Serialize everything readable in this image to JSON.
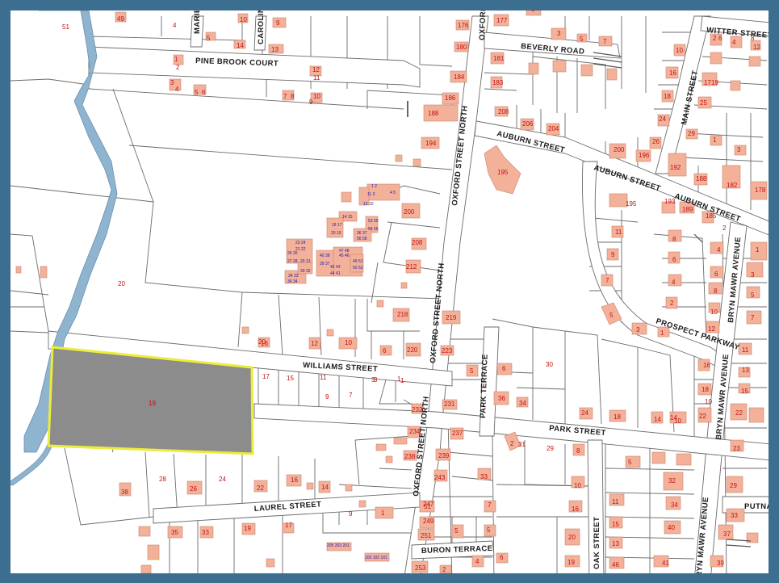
{
  "map": {
    "frame_color": "#3c6e8f",
    "highlight_outline_color": "#ecec3a",
    "highlight_fill_color": "#8c8c8c",
    "building_color": "#f4b19a",
    "water_color": "#8fb4cf",
    "label_color": "#c01010"
  },
  "streets": {
    "pine_brook_court": "PINE BROOK COURT",
    "beverly_road": "BEVERLY ROAD",
    "witter_street": "WITTER STREET",
    "main_street": "MAIN STREET",
    "auburn_street_1": "AUBURN STREET",
    "auburn_street_2": "AUBURN STREET",
    "auburn_street_3": "AUBURN STREET",
    "oxford_street_north_1": "OXFORD STREET NORTH",
    "oxford_street_north_2": "OXFORD STREET NORTH",
    "oxford_street_north_3": "OXFORD STREET NORTH",
    "oxford_top": "OXFORD",
    "marie": "MARIE",
    "carolina": "CAROLINA",
    "williams_street": "WILLIAMS STREET",
    "park_terrace": "PARK TERRACE",
    "park_street": "PARK STREET",
    "prospect_parkway": "PROSPECT PARKWAY",
    "bryn_mawr_avenue_1": "BRYN MAWR AVENUE",
    "bryn_mawr_avenue_2": "BRYN MAWR AVENUE",
    "bryn_mawr_avenue_3": "BRYN MAWR AVENUE",
    "laurel_street": "LAUREL STREET",
    "oak_street": "OAK STREET",
    "buron_terrace": "BURON TERRACE",
    "putnam": "PUTNA"
  },
  "highlight": {
    "parcel_number": "19"
  },
  "lots": [
    "49",
    "4",
    "5",
    "10",
    "14",
    "9",
    "13",
    "176",
    "180",
    "184",
    "186",
    "188",
    "177",
    "1",
    "3",
    "5",
    "7",
    "181",
    "183",
    "208",
    "206",
    "204",
    "10",
    "16",
    "17",
    "19",
    "18",
    "25",
    "24",
    "26",
    "29",
    "1",
    "3",
    "192",
    "188",
    "182",
    "178",
    "200",
    "196",
    "2",
    "4",
    "6",
    "8",
    "12",
    "1",
    "2",
    "3",
    "4",
    "5",
    "6",
    "12",
    "11",
    "7",
    "8",
    "10",
    "9",
    "194",
    "195",
    "195",
    "193",
    "189",
    "185",
    "2",
    "11",
    "9",
    "7",
    "5",
    "8",
    "6",
    "4",
    "2",
    "3",
    "1",
    "10",
    "12",
    "16",
    "18",
    "22",
    "14",
    "10",
    "13",
    "15",
    "11",
    "7",
    "3",
    "5",
    "1",
    "4",
    "6",
    "8",
    "200",
    "208",
    "212",
    "218",
    "220",
    "219",
    "223",
    "5",
    "6",
    "30",
    "231",
    "36",
    "34",
    "24",
    "18",
    "14",
    "10",
    "22",
    "23",
    "29",
    "33",
    "37",
    "39",
    "41",
    "46",
    "19",
    "20",
    "16",
    "10",
    "8",
    "2",
    "5",
    "15",
    "13",
    "11",
    "34",
    "32",
    "40",
    "51",
    "20",
    "16",
    "12",
    "10",
    "6",
    "17",
    "15",
    "11",
    "3",
    "1",
    "9",
    "7",
    "232",
    "234",
    "237",
    "238",
    "239",
    "243",
    "33",
    "31",
    "29",
    "28",
    "26",
    "24",
    "22",
    "16",
    "14",
    "38",
    "35",
    "33",
    "19",
    "17",
    "9",
    "1",
    "247",
    "249",
    "251",
    "253",
    "5",
    "7",
    "2",
    "4",
    "6",
    "5",
    "1",
    "3"
  ]
}
